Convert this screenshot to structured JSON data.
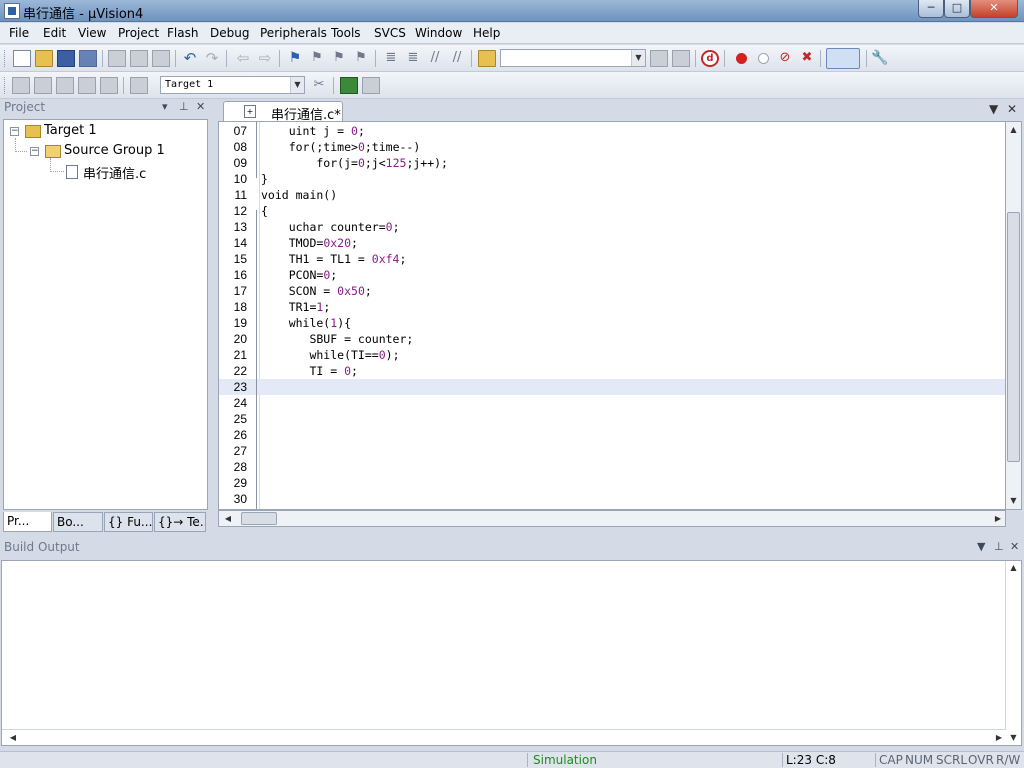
{
  "window": {
    "title": "串行通信 - µVision4",
    "minimize_glyph": "─",
    "maximize_glyph": "□",
    "close_glyph": "✕"
  },
  "menu": [
    "File",
    "Edit",
    "View",
    "Project",
    "Flash",
    "Debug",
    "Peripherals",
    "Tools",
    "SVCS",
    "Window",
    "Help"
  ],
  "toolbar": {
    "target_selector_value": "Target 1",
    "find_combo_value": ""
  },
  "project_pane": {
    "title": "Project",
    "tree": {
      "root": "Target 1",
      "group": "Source Group 1",
      "file": "串行通信.c"
    },
    "tabs": [
      "Pr...",
      "Bo...",
      "{} Fu...",
      "{}→ Te..."
    ]
  },
  "editor": {
    "file_tab": "串行通信.c*",
    "lines": [
      {
        "no": "07",
        "code": "    uint j = 0;"
      },
      {
        "no": "08",
        "code": "    for(;time>0;time--)"
      },
      {
        "no": "09",
        "code": "        for(j=0;j<125;j++);"
      },
      {
        "no": "10",
        "code": "}"
      },
      {
        "no": "11",
        "code": "void main()"
      },
      {
        "no": "12",
        "code": "{"
      },
      {
        "no": "13",
        "code": "    uchar counter=0;"
      },
      {
        "no": "14",
        "code": "    TMOD=0x20;"
      },
      {
        "no": "15",
        "code": "    TH1 = TL1 = 0xf4;"
      },
      {
        "no": "16",
        "code": "    PCON=0;"
      },
      {
        "no": "17",
        "code": "    SCON = 0x50;"
      },
      {
        "no": "18",
        "code": "    TR1=1;"
      },
      {
        "no": "19",
        "code": "    while(1){"
      },
      {
        "no": "20",
        "code": "       SBUF = counter;"
      },
      {
        "no": "21",
        "code": "       while(TI==0);"
      },
      {
        "no": "22",
        "code": "       TI = 0;"
      },
      {
        "no": "23",
        "code": ""
      },
      {
        "no": "24",
        "code": ""
      },
      {
        "no": "25",
        "code": ""
      },
      {
        "no": "26",
        "code": ""
      },
      {
        "no": "27",
        "code": ""
      },
      {
        "no": "28",
        "code": ""
      },
      {
        "no": "29",
        "code": ""
      },
      {
        "no": "30",
        "code": ""
      }
    ],
    "current_line": "23"
  },
  "build_output": {
    "title": "Build Output",
    "text": ""
  },
  "status": {
    "mode": "Simulation",
    "cursor": "L:23 C:8",
    "caps": "CAP",
    "num": "NUM",
    "scrl": "SCRL",
    "ovr": "OVR",
    "rw": "R/W"
  },
  "colors": {
    "number_literal": "#8b1a8b",
    "current_line_bg": "#e3e9f7",
    "status_mode": "#1f8a1f"
  }
}
